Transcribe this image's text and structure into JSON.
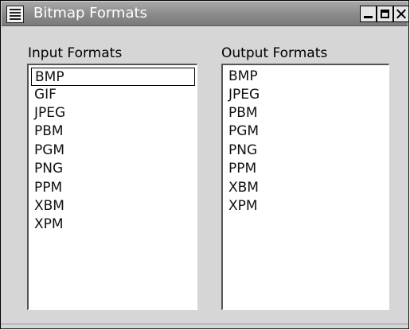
{
  "window": {
    "title": "Bitmap Formats"
  },
  "input_formats": {
    "label": "Input Formats",
    "items": [
      "BMP",
      "GIF",
      "JPEG",
      "PBM",
      "PGM",
      "PNG",
      "PPM",
      "XBM",
      "XPM"
    ],
    "selected": "BMP"
  },
  "output_formats": {
    "label": "Output Formats",
    "items": [
      "BMP",
      "JPEG",
      "PBM",
      "PGM",
      "PNG",
      "PPM",
      "XBM",
      "XPM"
    ]
  },
  "icons": {
    "window_menu": "window-menu-icon",
    "minimize": "minimize-icon",
    "maximize": "maximize-icon",
    "close": "close-icon"
  }
}
